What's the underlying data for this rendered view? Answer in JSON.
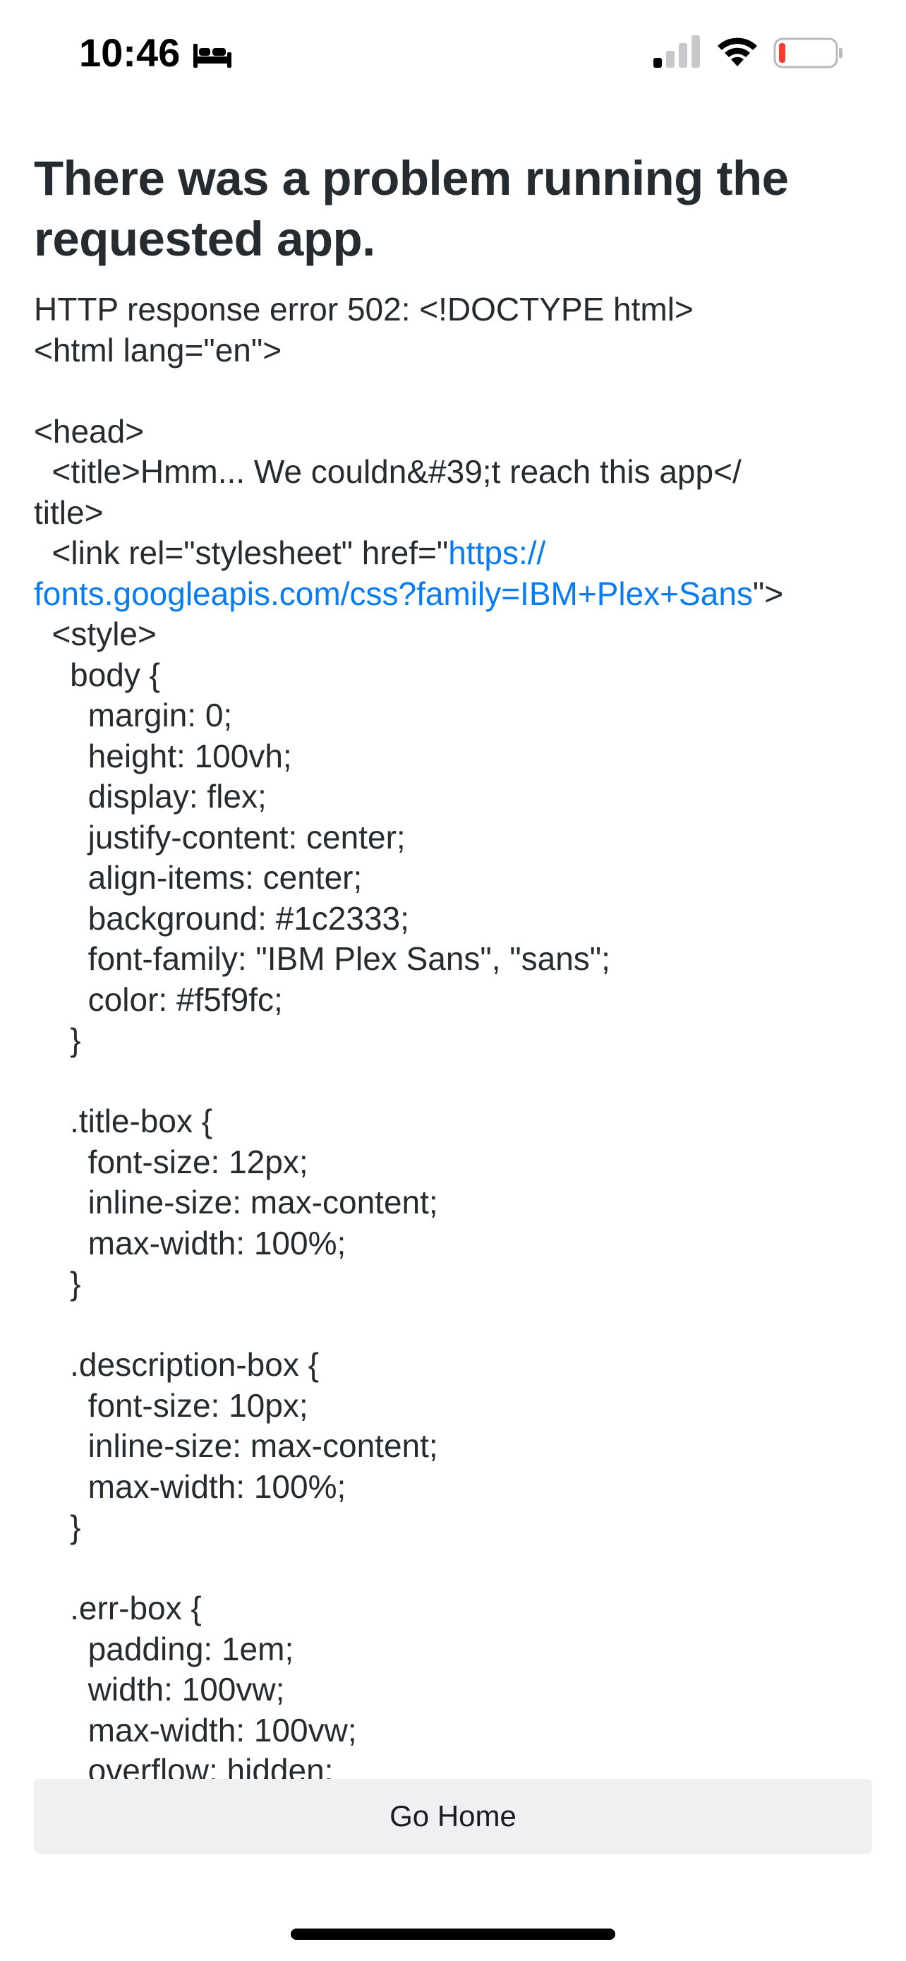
{
  "status_bar": {
    "time": "10:46",
    "sleep_icon": "bed-icon",
    "signal_icon": "cellular-signal-icon",
    "wifi_icon": "wifi-icon",
    "battery_icon": "battery-low-icon",
    "battery_level": 0.12,
    "battery_color": "#ff3b30"
  },
  "page": {
    "title": "There was a problem running the requested app.",
    "error_lines": [
      {
        "text": "HTTP response error 502: <!DOCTYPE html>"
      },
      {
        "text": "<html lang=\"en\">"
      },
      {
        "text": ""
      },
      {
        "text": "<head>"
      },
      {
        "text": "  <title>Hmm... We couldn&#39;t reach this app</"
      },
      {
        "text": "title>"
      },
      {
        "text": "  <link rel=\"stylesheet\" href=\"",
        "link": "https://"
      },
      {
        "link": "fonts.googleapis.com/css?family=IBM+Plex+Sans",
        "after": "\">"
      },
      {
        "text": "  <style>"
      },
      {
        "text": "    body {"
      },
      {
        "text": "      margin: 0;"
      },
      {
        "text": "      height: 100vh;"
      },
      {
        "text": "      display: flex;"
      },
      {
        "text": "      justify-content: center;"
      },
      {
        "text": "      align-items: center;"
      },
      {
        "text": "      background: #1c2333;"
      },
      {
        "text": "      font-family: \"IBM Plex Sans\", \"sans\";"
      },
      {
        "text": "      color: #f5f9fc;"
      },
      {
        "text": "    }"
      },
      {
        "text": ""
      },
      {
        "text": "    .title-box {"
      },
      {
        "text": "      font-size: 12px;"
      },
      {
        "text": "      inline-size: max-content;"
      },
      {
        "text": "      max-width: 100%;"
      },
      {
        "text": "    }"
      },
      {
        "text": ""
      },
      {
        "text": "    .description-box {"
      },
      {
        "text": "      font-size: 10px;"
      },
      {
        "text": "      inline-size: max-content;"
      },
      {
        "text": "      max-width: 100%;"
      },
      {
        "text": "    }"
      },
      {
        "text": ""
      },
      {
        "text": "    .err-box {"
      },
      {
        "text": "      padding: 1em;"
      },
      {
        "text": "      width: 100vw;"
      },
      {
        "text": "      max-width: 100vw;"
      },
      {
        "text": "      overflow: hidden;"
      }
    ],
    "link_color": "#0a7cf2"
  },
  "actions": {
    "go_home_label": "Go Home"
  }
}
